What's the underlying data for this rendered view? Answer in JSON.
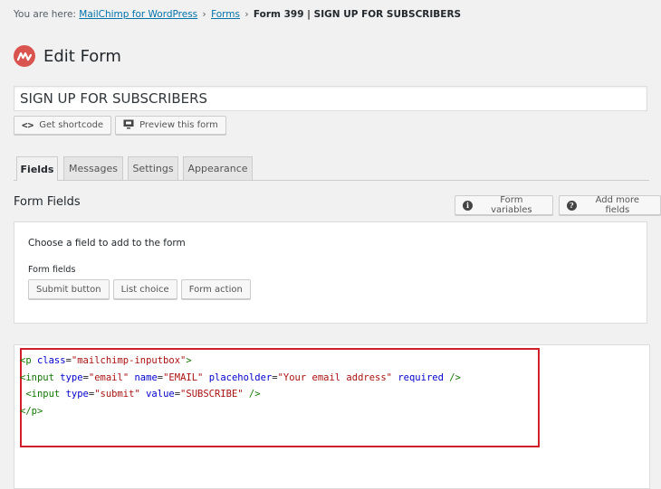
{
  "breadcrumb": {
    "prefix": "You are here: ",
    "link1": "MailChimp for WordPress",
    "sep": "›",
    "link2": "Forms",
    "current": "Form 399 | SIGN UP FOR SUBSCRIBERS"
  },
  "page": {
    "title": "Edit Form"
  },
  "form": {
    "name": "SIGN UP FOR SUBSCRIBERS"
  },
  "actions": {
    "shortcode": "Get shortcode",
    "preview": "Preview this form"
  },
  "tabs": [
    {
      "label": "Fields",
      "active": true
    },
    {
      "label": "Messages"
    },
    {
      "label": "Settings"
    },
    {
      "label": "Appearance"
    }
  ],
  "section": {
    "title": "Form Fields",
    "form_variables": "Form variables",
    "add_more_fields": "Add more fields"
  },
  "field_box": {
    "choose": "Choose a field to add to the form",
    "label": "Form fields",
    "buttons": [
      "Submit button",
      "List choice",
      "Form action"
    ]
  },
  "editor": {
    "line1": {
      "open": "<p ",
      "attr1": "class",
      "eq": "=",
      "val1": "\"mailchimp-inputbox\"",
      "close": ">"
    },
    "line2": {
      "open": "<input ",
      "a1": "type",
      "v1": "\"email\"",
      "a2": "name",
      "v2": "\"EMAIL\"",
      "a3": "placeholder",
      "v3": "\"Your email address\"",
      "a4": "required",
      "close": " />"
    },
    "line3": {
      "open": " <input ",
      "a1": "type",
      "v1": "\"submit\"",
      "a2": "value",
      "v2": "\"SUBSCRIBE\"",
      "close": " />"
    },
    "line4": "</p>"
  },
  "colors": {
    "accent_red": "#d31f2a",
    "link": "#0073aa",
    "logo": "#d9534f"
  }
}
